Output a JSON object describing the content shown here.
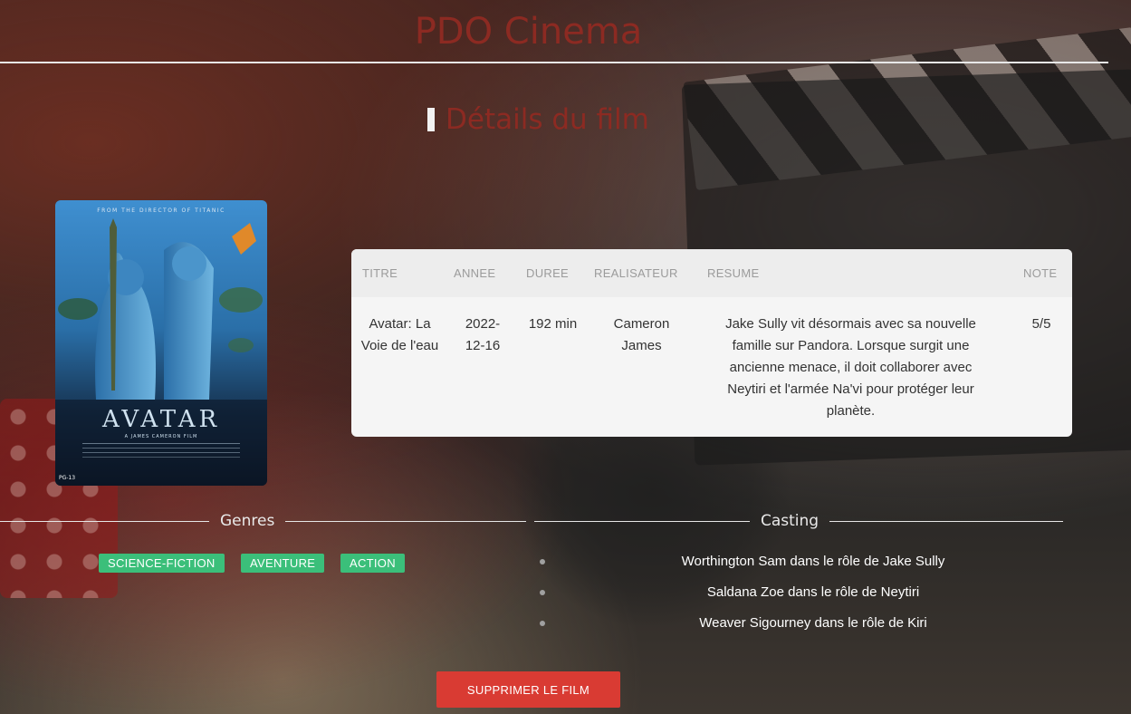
{
  "app": {
    "title": "PDO Cinema"
  },
  "section": {
    "title": "Détails du film"
  },
  "poster": {
    "title_text": "AVATAR",
    "tagline_top": "FROM THE DIRECTOR OF TITANIC",
    "subtitle": "A JAMES CAMERON FILM",
    "rating": "PG-13"
  },
  "table": {
    "headers": {
      "titre": "TITRE",
      "annee": "ANNEE",
      "duree": "DUREE",
      "realisateur": "REALISATEUR",
      "resume": "RESUME",
      "note": "NOTE"
    },
    "row": {
      "titre": "Avatar: La Voie de l'eau",
      "annee": "2022-12-16",
      "duree": "192 min",
      "realisateur": "Cameron James",
      "resume": "Jake Sully vit désormais avec sa nouvelle famille sur Pandora. Lorsque surgit une ancienne menace, il doit collaborer avec Neytiri et l'armée Na'vi pour protéger leur planète.",
      "note": "5/5"
    }
  },
  "genres": {
    "label": "Genres",
    "items": [
      "SCIENCE-FICTION",
      "AVENTURE",
      "ACTION"
    ],
    "badge_color": "#3bbf7a"
  },
  "casting": {
    "label": "Casting",
    "items": [
      "Worthington Sam dans le rôle de Jake Sully",
      "Saldana Zoe dans le rôle de Neytiri",
      "Weaver Sigourney dans le rôle de Kiri"
    ]
  },
  "actions": {
    "delete_label": "SUPPRIMER LE FILM",
    "delete_color": "#d93b33"
  },
  "colors": {
    "accent": "#8c2a22"
  }
}
